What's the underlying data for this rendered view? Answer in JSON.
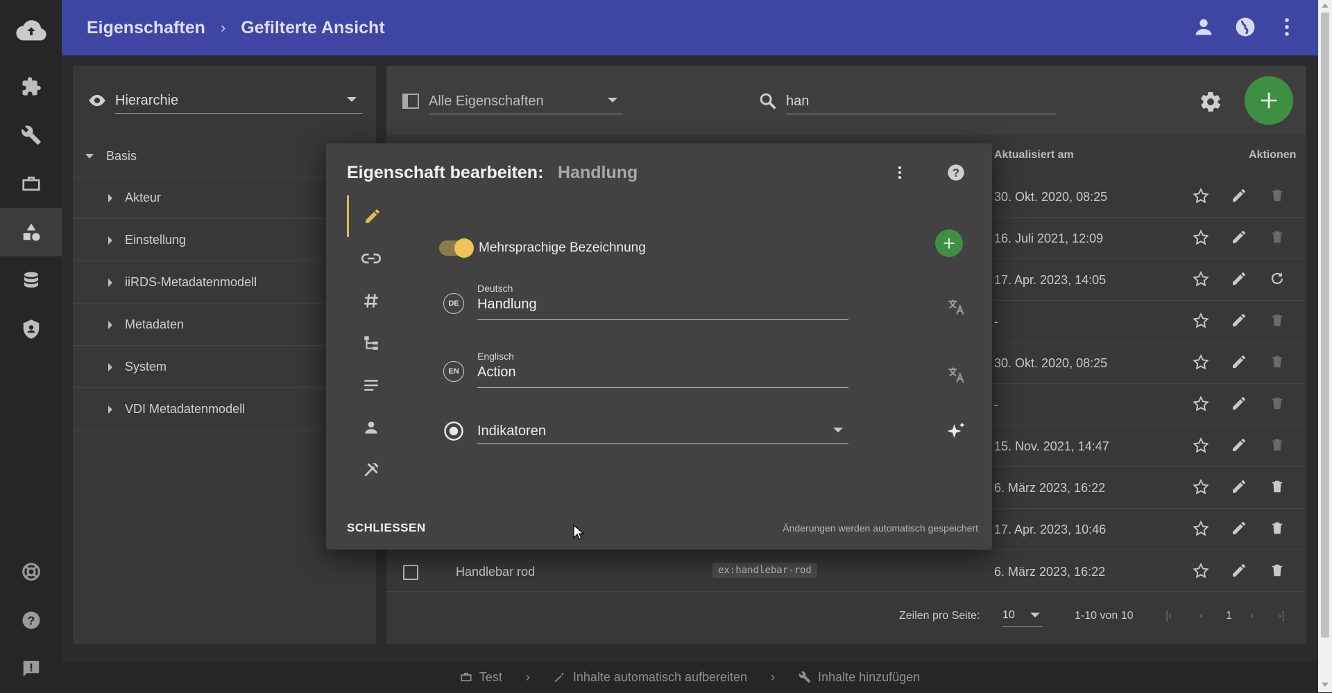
{
  "breadcrumb": {
    "root": "Eigenschaften",
    "current": "Gefilterte Ansicht"
  },
  "rail": {
    "icons": [
      "cloud-sync-icon",
      "puzzle-icon",
      "wrench-icon",
      "briefcase-icon",
      "shapes-icon",
      "database-icon",
      "shield-icon",
      "lifebuoy-icon",
      "help-icon",
      "feedback-icon"
    ]
  },
  "left_panel": {
    "view_select": "Hierarchie",
    "tree": [
      {
        "label": "Basis",
        "expanded": true
      },
      {
        "label": "Akteur"
      },
      {
        "label": "Einstellung"
      },
      {
        "label": "iiRDS-Metadatenmodell"
      },
      {
        "label": "Metadaten"
      },
      {
        "label": "System"
      },
      {
        "label": "VDI Metadatenmodell"
      }
    ]
  },
  "toolbar": {
    "filter_select": "Alle Eigenschaften",
    "search_value": "han"
  },
  "table": {
    "headers": {
      "updated": "Aktualisiert am",
      "actions": "Aktionen"
    },
    "rows": [
      {
        "date": "30. Okt. 2020, 08:25"
      },
      {
        "date": "16. Juli 2021, 12:09"
      },
      {
        "date": "17. Apr. 2023, 14:05"
      },
      {
        "date": "-"
      },
      {
        "date": "30. Okt. 2020, 08:25"
      },
      {
        "date": "-"
      },
      {
        "date": "15. Nov. 2021, 14:47"
      },
      {
        "date": "6. März 2023, 16:22"
      },
      {
        "date": "17. Apr. 2023, 10:46"
      },
      {
        "date": "6. März 2023, 16:22",
        "name": "Handlebar rod",
        "key": "ex:handlebar-rod"
      }
    ]
  },
  "pagination": {
    "rows_label": "Zeilen pro Seite:",
    "rows_value": "10",
    "range": "1-10 von 10",
    "page": "1"
  },
  "bottom_bar": {
    "items": [
      "Test",
      "Inhalte automatisch aufbereiten",
      "Inhalte hinzufügen"
    ]
  },
  "dialog": {
    "title": "Eigenschaft bearbeiten:",
    "subtitle": "Handlung",
    "toggle_label": "Mehrsprachige Bezeichnung",
    "fields": [
      {
        "badge": "DE",
        "label": "Deutsch",
        "value": "Handlung"
      },
      {
        "badge": "EN",
        "label": "Englisch",
        "value": "Action"
      }
    ],
    "indicator_select": "Indikatoren",
    "close_label": "SCHLIESSEN",
    "autosave_note": "Änderungen werden automatisch gespeichert"
  },
  "colors": {
    "topbar": "#3f45a3",
    "accent": "#f0c259",
    "green": "#3f8f43"
  }
}
